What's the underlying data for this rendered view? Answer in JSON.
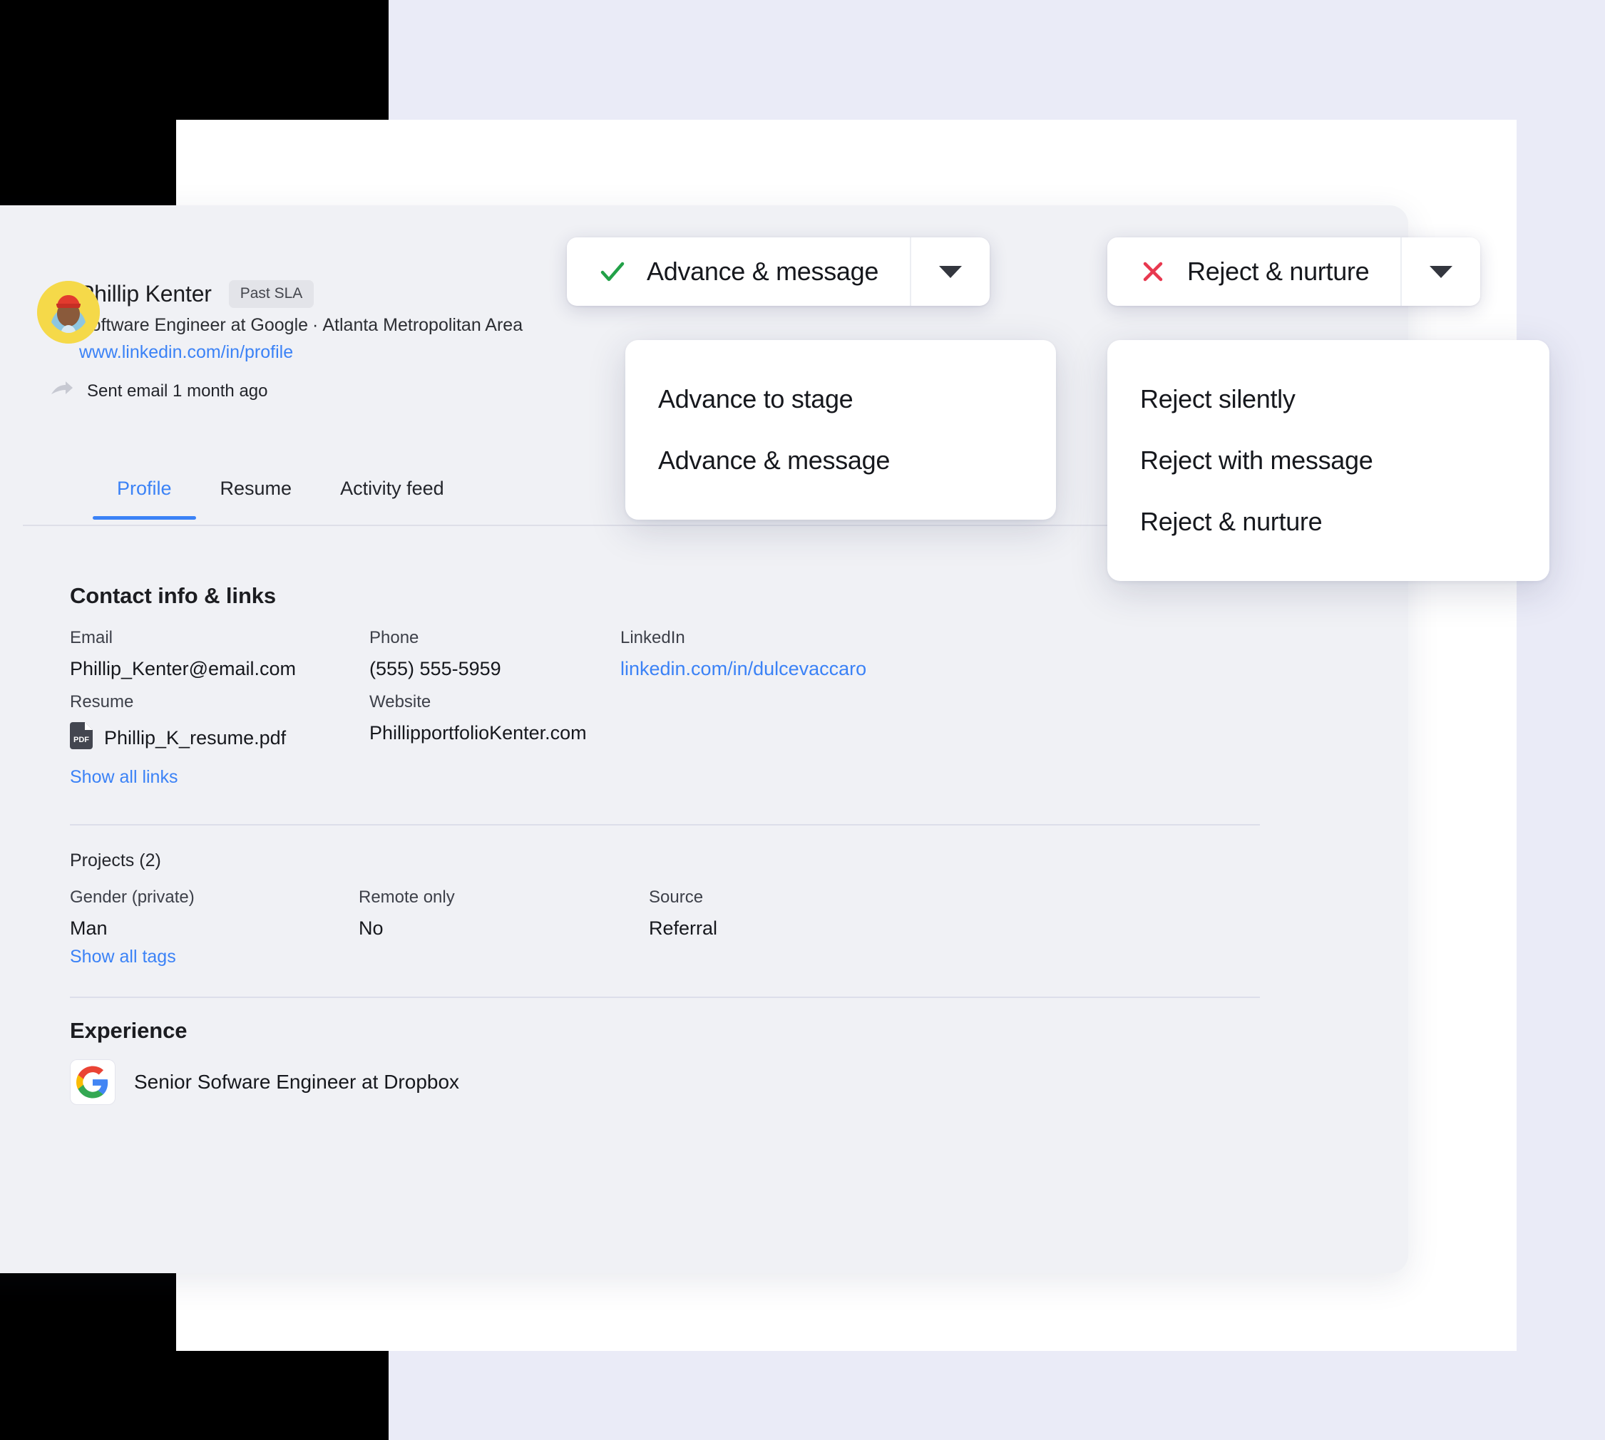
{
  "colors": {
    "page_background": "#eaebf7",
    "panel_background": "#f0f1f5",
    "card_background": "#ffffff",
    "accent_blue": "#3b82f6",
    "success_green": "#22a148",
    "danger_red": "#e8384f",
    "divider": "#dcdeea"
  },
  "candidate": {
    "name": "Phillip Kenter",
    "badge": "Past SLA",
    "headline": "Software Engineer at Google",
    "separator": "·",
    "location": "Atlanta Metropolitan Area",
    "profile_url": "www.linkedin.com/in/profile",
    "activity": "Sent email 1 month ago",
    "activity_icon": "forward-arrow-icon",
    "avatar_icon": "avatar"
  },
  "tabs": [
    {
      "label": "Profile",
      "active": true
    },
    {
      "label": "Resume",
      "active": false
    },
    {
      "label": "Activity feed",
      "active": false
    }
  ],
  "actions": {
    "advance": {
      "label": "Advance & message",
      "icon": "check-icon",
      "caret_icon": "chevron-down-icon",
      "menu": [
        "Advance to stage",
        "Advance & message"
      ]
    },
    "reject": {
      "label": "Reject & nurture",
      "icon": "close-x-icon",
      "caret_icon": "chevron-down-icon",
      "menu": [
        "Reject silently",
        "Reject with message",
        "Reject & nurture"
      ]
    }
  },
  "contact": {
    "title": "Contact info & links",
    "email": {
      "label": "Email",
      "value": "Phillip_Kenter@email.com"
    },
    "phone": {
      "label": "Phone",
      "value": "(555) 555-5959"
    },
    "linkedin": {
      "label": "LinkedIn",
      "value": "linkedin.com/in/dulcevaccaro"
    },
    "resume": {
      "label": "Resume",
      "value": "Phillip_K_resume.pdf",
      "icon": "pdf-file-icon"
    },
    "website": {
      "label": "Website",
      "value": "PhillipportfolioKenter.com"
    },
    "show_all_links": "Show all links"
  },
  "tags": {
    "projects_label": "Projects (2)",
    "gender": {
      "label": "Gender (private)",
      "value": "Man"
    },
    "remote": {
      "label": "Remote only",
      "value": "No"
    },
    "source": {
      "label": "Source",
      "value": "Referral"
    },
    "show_all_tags": "Show all tags"
  },
  "experience": {
    "title": "Experience",
    "items": [
      {
        "logo_icon": "google-logo-icon",
        "text": "Senior Sofware Engineer at Dropbox"
      }
    ]
  }
}
